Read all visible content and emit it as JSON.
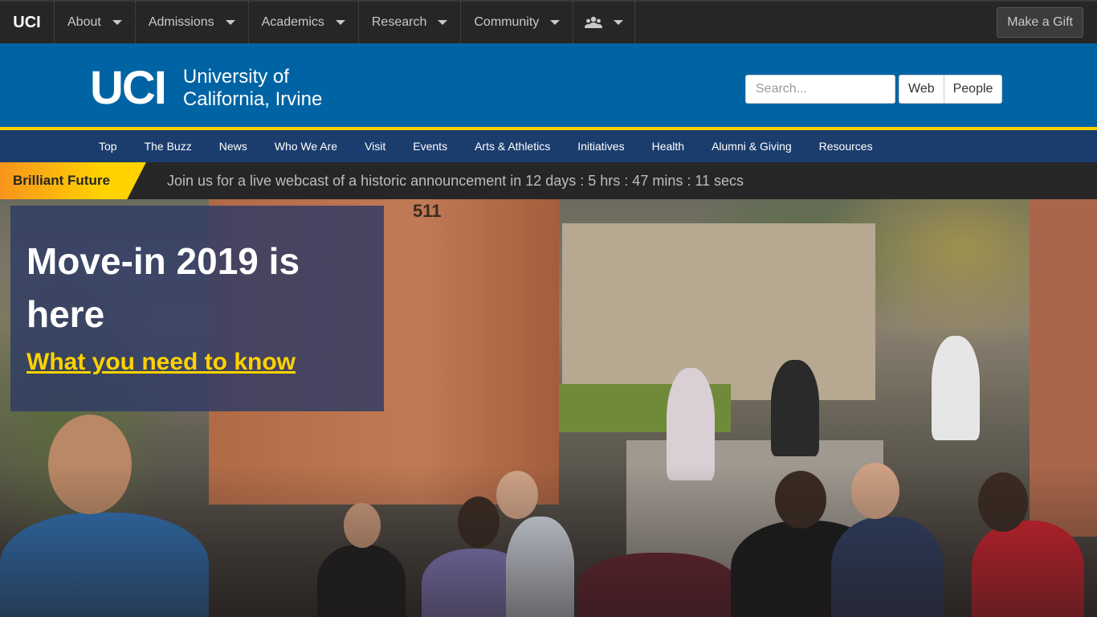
{
  "topbar": {
    "brand": "UCI",
    "menus": [
      "About",
      "Admissions",
      "Academics",
      "Research",
      "Community"
    ],
    "people_icon": "people-icon",
    "gift_label": "Make a Gift"
  },
  "header": {
    "logo_mark": "UCI",
    "logo_line1": "University of",
    "logo_line2": "California, Irvine",
    "search_placeholder": "Search...",
    "search_scope": [
      "Web",
      "People"
    ]
  },
  "mainnav": {
    "items": [
      "Top",
      "The Buzz",
      "News",
      "Who We Are",
      "Visit",
      "Events",
      "Arts & Athletics",
      "Initiatives",
      "Health",
      "Alumni & Giving",
      "Resources"
    ]
  },
  "announcement": {
    "tag": "Brilliant Future",
    "message": "Join us for a live webcast of a historic announcement in 12 days : 5 hrs : 47 mins : 11 secs"
  },
  "hero": {
    "title": "Move-in 2019 is here",
    "link": "What you need to know",
    "building_number": "511"
  },
  "colors": {
    "uci_blue": "#0064a4",
    "uci_gold": "#ffd200",
    "nav_navy": "#1b3d6d",
    "topbar": "#262626"
  }
}
